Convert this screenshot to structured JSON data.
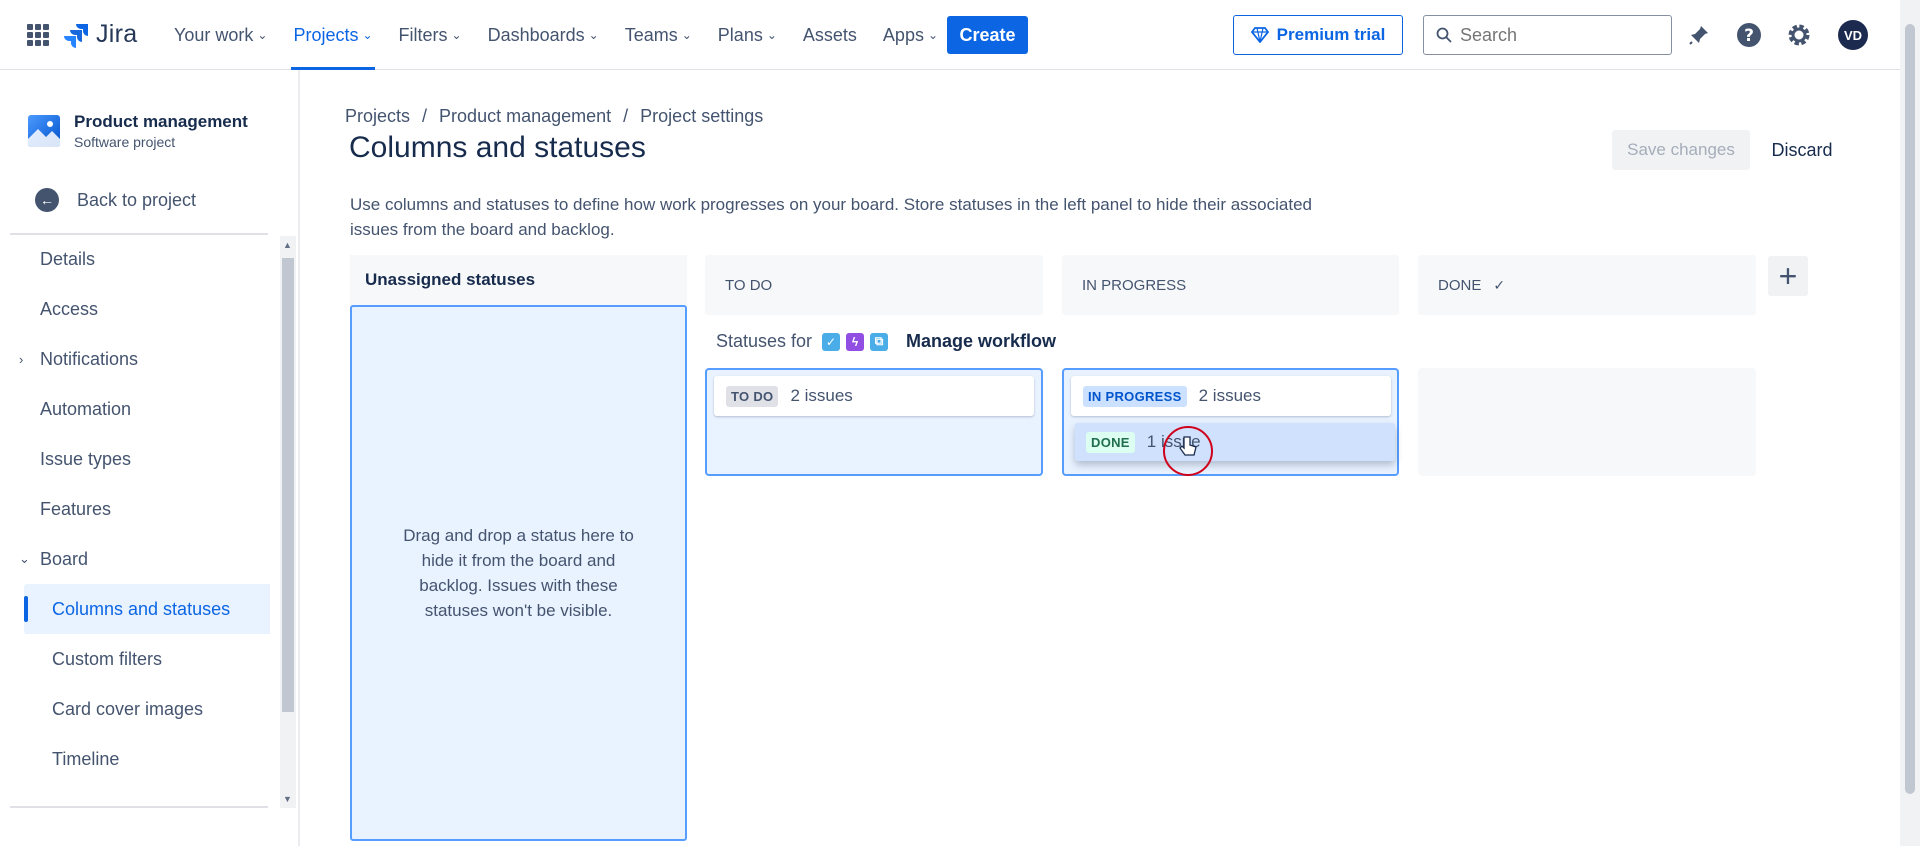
{
  "topnav": {
    "logo": "Jira",
    "links": [
      {
        "label": "Your work",
        "dropdown": true
      },
      {
        "label": "Projects",
        "dropdown": true,
        "active": true
      },
      {
        "label": "Filters",
        "dropdown": true
      },
      {
        "label": "Dashboards",
        "dropdown": true
      },
      {
        "label": "Teams",
        "dropdown": true
      },
      {
        "label": "Plans",
        "dropdown": true
      },
      {
        "label": "Assets",
        "dropdown": false
      },
      {
        "label": "Apps",
        "dropdown": true
      }
    ],
    "create_label": "Create",
    "premium_label": "Premium trial",
    "search_placeholder": "Search",
    "avatar_initials": "VD"
  },
  "sidebar": {
    "project_name": "Product management",
    "project_type": "Software project",
    "back_label": "Back to project",
    "items": [
      {
        "label": "Details"
      },
      {
        "label": "Access"
      },
      {
        "label": "Notifications"
      },
      {
        "label": "Automation"
      },
      {
        "label": "Issue types"
      },
      {
        "label": "Features"
      },
      {
        "label": "Board"
      },
      {
        "label": "Columns and statuses"
      },
      {
        "label": "Custom filters"
      },
      {
        "label": "Card cover images"
      },
      {
        "label": "Timeline"
      }
    ]
  },
  "breadcrumbs": [
    "Projects",
    "/",
    "Product management",
    "/",
    "Project settings"
  ],
  "page": {
    "title": "Columns and statuses",
    "save_label": "Save changes",
    "discard_label": "Discard",
    "description": "Use columns and statuses to define how work progresses on your board. Store statuses in the left panel to hide their associated issues from the board and backlog."
  },
  "board": {
    "unassigned_title": "Unassigned statuses",
    "unassigned_hint": "Drag and drop a status here to hide it from the board and backlog. Issues with these statuses won't be visible.",
    "columns": [
      {
        "name": "TO DO"
      },
      {
        "name": "IN PROGRESS"
      },
      {
        "name": "DONE"
      }
    ],
    "statuses_for_label": "Statuses for",
    "manage_workflow_label": "Manage workflow",
    "cards": {
      "todo": {
        "lozenge": "TO DO",
        "count": "2 issues"
      },
      "inprogress": {
        "lozenge": "IN PROGRESS",
        "count": "2 issues"
      },
      "dragging": {
        "lozenge": "DONE",
        "count": "1 issue"
      }
    }
  },
  "colors": {
    "accent": "#0c66e4",
    "done_check": "✓"
  }
}
